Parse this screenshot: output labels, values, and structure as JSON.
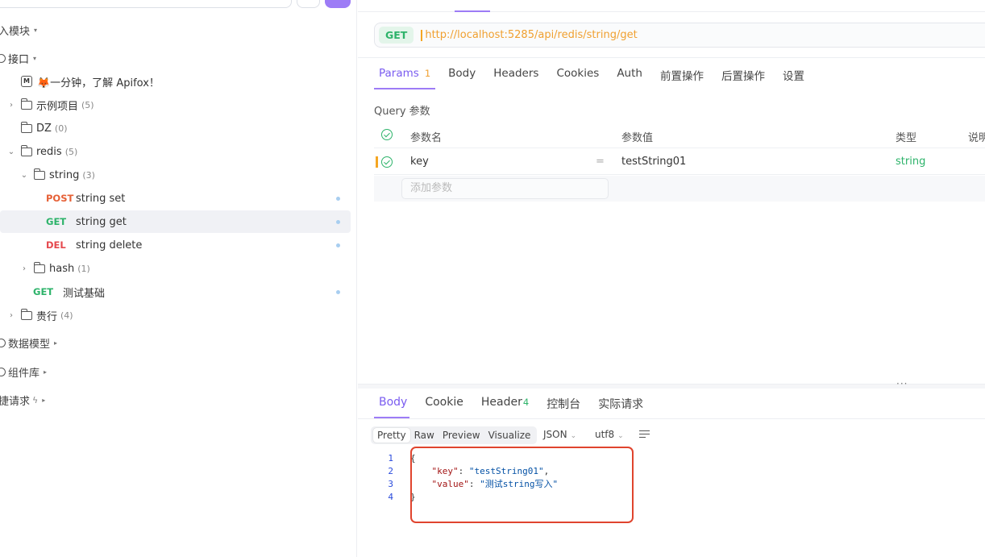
{
  "sidebar": {
    "section_module": "入模块",
    "section_interface": "接口",
    "items": [
      {
        "kind": "doc",
        "label": "🦊一分钟，了解 Apifox！"
      },
      {
        "kind": "folder",
        "label": "示例项目",
        "count": "(5)"
      },
      {
        "kind": "folder",
        "label": "DZ",
        "count": "(0)"
      },
      {
        "kind": "folder",
        "label": "redis",
        "count": "(5)"
      },
      {
        "kind": "folder",
        "label": "string",
        "count": "(3)"
      },
      {
        "kind": "api",
        "method": "POST",
        "label": "string set"
      },
      {
        "kind": "api",
        "method": "GET",
        "label": "string get"
      },
      {
        "kind": "api",
        "method": "DEL",
        "label": "string delete"
      },
      {
        "kind": "folder",
        "label": "hash",
        "count": "(1)"
      },
      {
        "kind": "api",
        "method": "GET",
        "label": "测试基础"
      },
      {
        "kind": "folder",
        "label": "贵行",
        "count": "(4)"
      }
    ],
    "section_models": "数据模型",
    "section_components": "组件库",
    "section_requests": "捷请求",
    "doc_icon_letter": "M"
  },
  "request": {
    "method": "GET",
    "url": "http://localhost:5285/api/redis/string/get",
    "tabs": [
      {
        "label": "Params",
        "count": "1"
      },
      {
        "label": "Body"
      },
      {
        "label": "Headers"
      },
      {
        "label": "Cookies"
      },
      {
        "label": "Auth"
      },
      {
        "label": "前置操作"
      },
      {
        "label": "后置操作"
      },
      {
        "label": "设置"
      }
    ],
    "query_title": "Query 参数",
    "columns": [
      "参数名",
      "参数值",
      "类型",
      "说明"
    ],
    "params": [
      {
        "name": "key",
        "eq": "=",
        "value": "testString01",
        "type": "string"
      }
    ],
    "add_placeholder": "添加参数"
  },
  "response": {
    "tabs": [
      {
        "label": "Body"
      },
      {
        "label": "Cookie"
      },
      {
        "label": "Header",
        "count": "4"
      },
      {
        "label": "控制台"
      },
      {
        "label": "实际请求"
      }
    ],
    "formats": [
      "Pretty",
      "Raw",
      "Preview",
      "Visualize"
    ],
    "type_select": "JSON",
    "encoding_select": "utf8",
    "line_numbers": [
      "1",
      "2",
      "3",
      "4"
    ],
    "body": {
      "key": "testString01",
      "value": "测试string写入"
    },
    "brace_open": "{",
    "brace_close": "}"
  },
  "colors": {
    "accent": "#9d7cf6",
    "get": "#2db36a",
    "post": "#e66036",
    "del": "#e5484d",
    "highlight_box": "#e0442e"
  }
}
